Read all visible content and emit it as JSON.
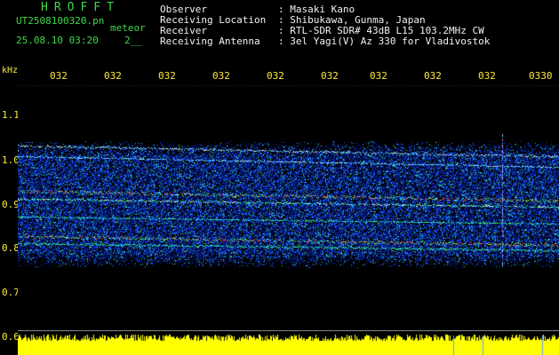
{
  "app": {
    "brand": "HROFFT",
    "file_name": "UT2508100320.pn",
    "mode": "meteor",
    "timestamp": "25.08.10 03:20",
    "counter": "2__"
  },
  "info": [
    {
      "label": "Observer",
      "value": ": Masaki Kano"
    },
    {
      "label": "Receiving Location",
      "value": ": Shibukawa, Gunma, Japan"
    },
    {
      "label": "Receiver",
      "value": ": RTL-SDR SDR# 43dB L15 103.2MHz CW"
    },
    {
      "label": "Receiving Antenna",
      "value": ": 3el Yagi(V) Az 330 for Vladivostok"
    }
  ],
  "axis": {
    "unit": "kHz",
    "time_ticks": [
      "032",
      "032",
      "032",
      "032",
      "032",
      "032",
      "032",
      "032",
      "032",
      "0330"
    ],
    "freq_ticks": [
      "1.1",
      "1.0",
      "0.9",
      "0.8",
      "0.7",
      "0.6"
    ]
  },
  "colors": {
    "background": "#000000",
    "header_green": "#3fd84a",
    "header_white": "#f2f2f2",
    "axis_yellow": "#ffea3a",
    "power_yellow": "#ffff00"
  }
}
